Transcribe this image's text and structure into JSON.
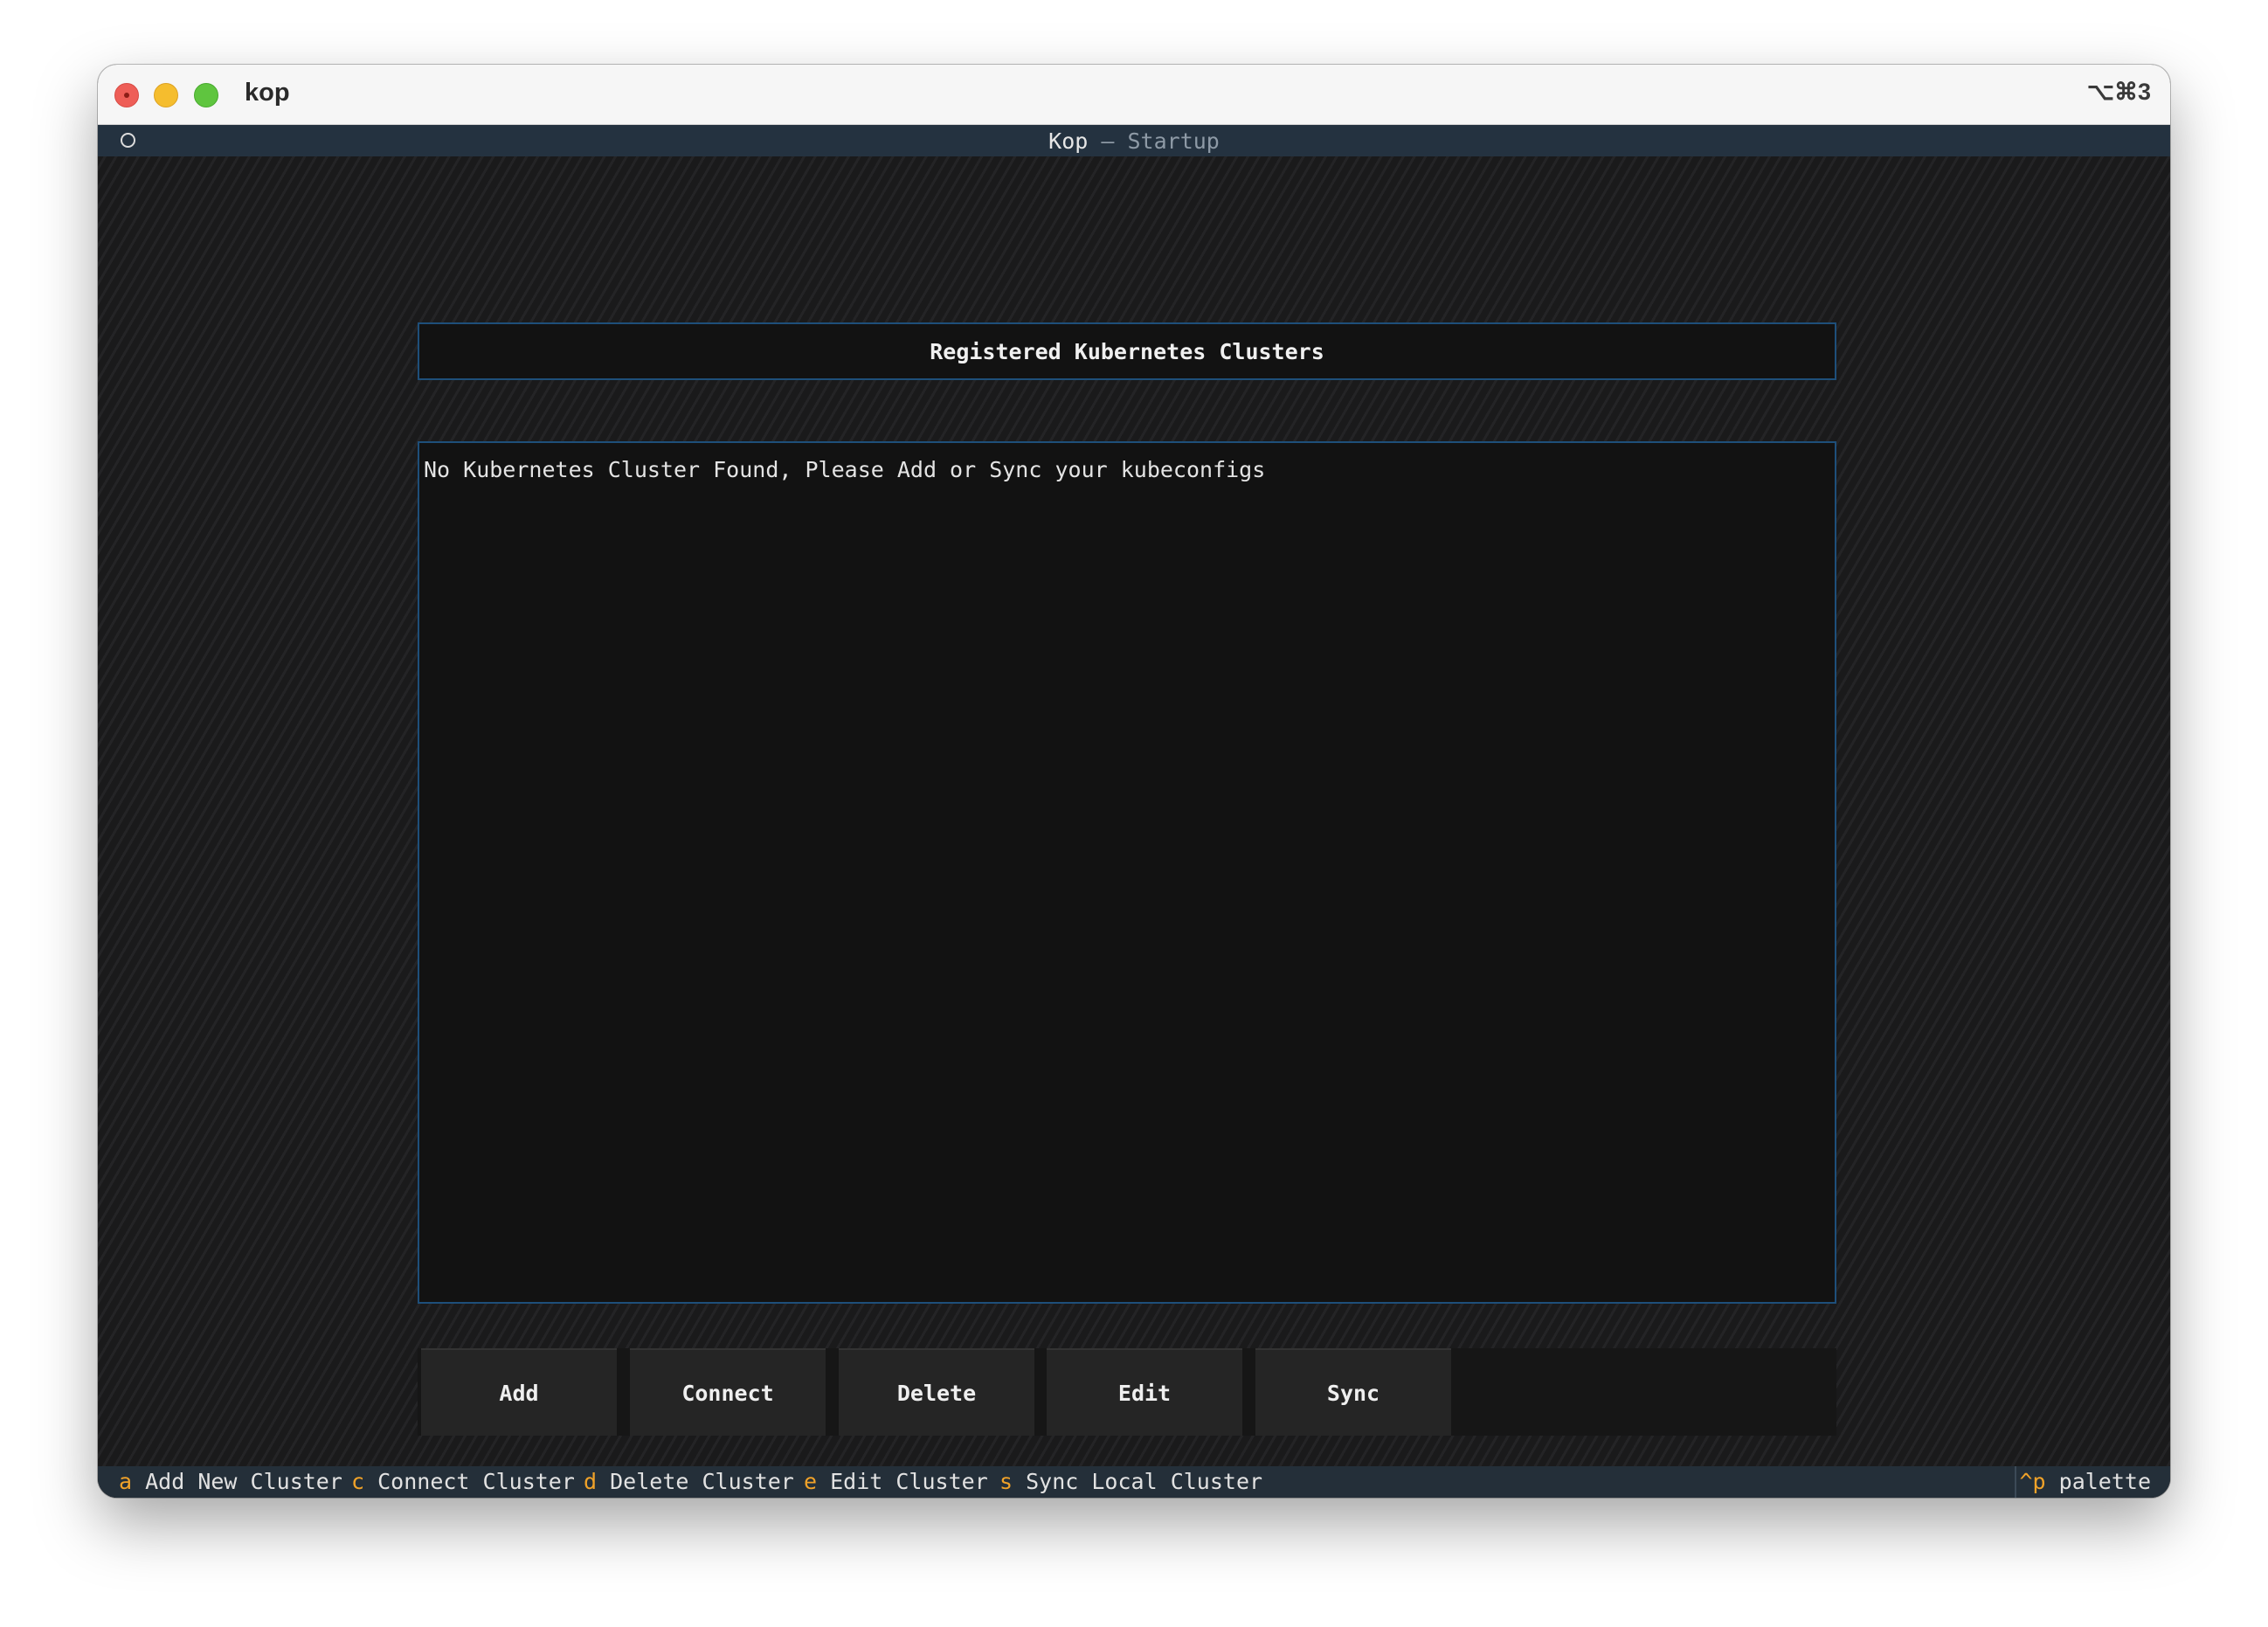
{
  "window": {
    "app_title": "kop",
    "shortcut": "⌥⌘3"
  },
  "header": {
    "title": "Kop",
    "separator": "—",
    "subtitle": "Startup"
  },
  "panel": {
    "title": "Registered Kubernetes Clusters",
    "empty_message": "No Kubernetes Cluster Found, Please Add or Sync your kubeconfigs"
  },
  "buttons": [
    {
      "label": "Add"
    },
    {
      "label": "Connect"
    },
    {
      "label": "Delete"
    },
    {
      "label": "Edit"
    },
    {
      "label": "Sync"
    }
  ],
  "footer": {
    "bindings": [
      {
        "key": "a",
        "label": "Add New Cluster"
      },
      {
        "key": "c",
        "label": "Connect Cluster"
      },
      {
        "key": "d",
        "label": "Delete Cluster"
      },
      {
        "key": "e",
        "label": "Edit Cluster"
      },
      {
        "key": "s",
        "label": "Sync Local Cluster"
      }
    ],
    "palette": {
      "key": "^p",
      "label": "palette"
    }
  },
  "colors": {
    "accent_border": "#1e4f7a",
    "key_highlight": "#f0a229",
    "header_bar": "#243240",
    "footer_bar": "#242f39"
  }
}
